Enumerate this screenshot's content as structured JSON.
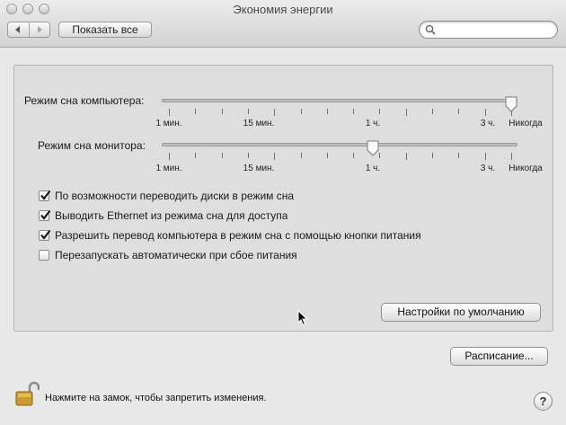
{
  "window": {
    "title": "Экономия энергии"
  },
  "toolbar": {
    "show_all_label": "Показать все",
    "back_icon": "back-arrow-icon",
    "forward_icon": "forward-arrow-icon",
    "search_placeholder": ""
  },
  "sliders": {
    "computer_sleep": {
      "label": "Режим сна компьютера:",
      "tick_labels": [
        "1 мин.",
        "15 мин.",
        "1 ч.",
        "3 ч.",
        "Никогда"
      ],
      "value": "Никогда"
    },
    "display_sleep": {
      "label": "Режим сна монитора:",
      "tick_labels": [
        "1 мин.",
        "15 мин.",
        "1 ч.",
        "3 ч.",
        "Никогда"
      ],
      "value": "1 ч."
    }
  },
  "options": [
    {
      "label": "По возможности переводить диски в режим сна",
      "checked": true
    },
    {
      "label": "Выводить Ethernet из режима сна для доступа",
      "checked": true
    },
    {
      "label": "Разрешить перевод компьютера в режим сна с помощью кнопки питания",
      "checked": true
    },
    {
      "label": "Перезапускать автоматически при сбое питания",
      "checked": false
    }
  ],
  "buttons": {
    "restore_defaults": "Настройки по умолчанию",
    "schedule": "Расписание..."
  },
  "footer": {
    "lock_text": "Нажмите на замок, чтобы запретить изменения.",
    "help_label": "?"
  }
}
